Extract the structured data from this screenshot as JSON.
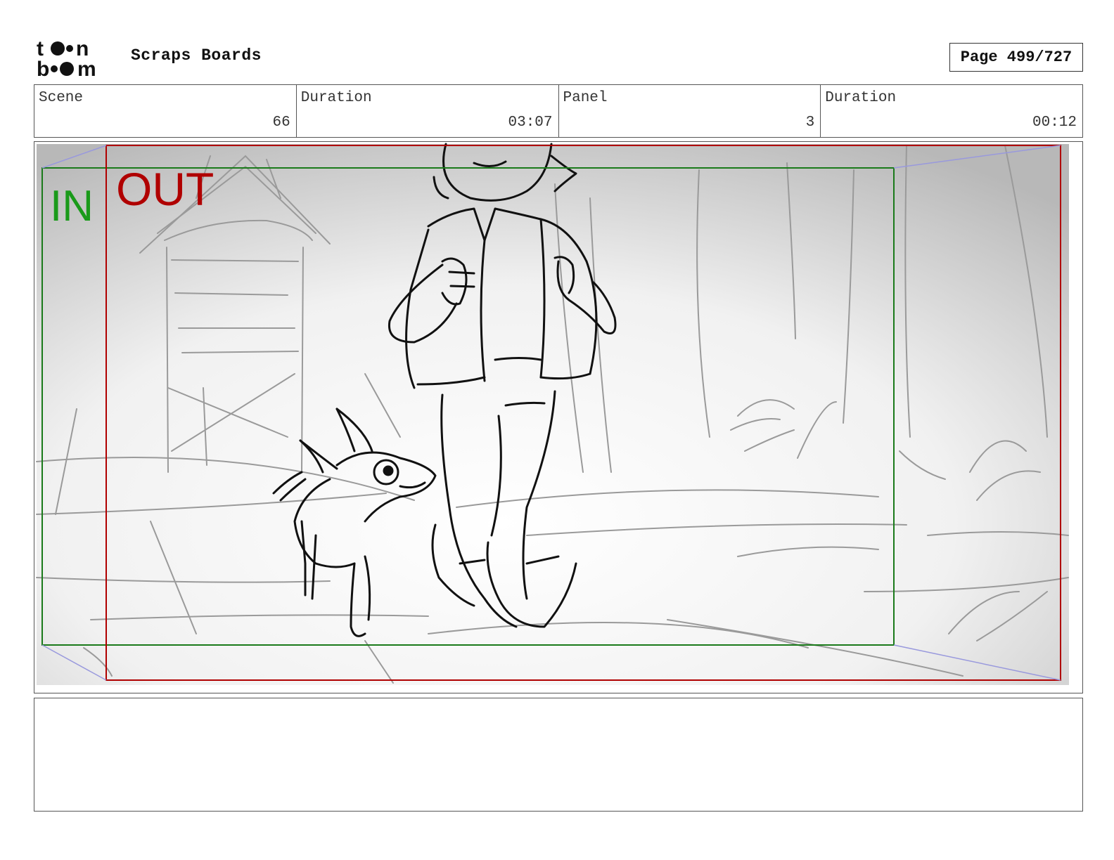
{
  "header": {
    "logo_text": "toon boom",
    "title": "Scraps Boards",
    "page_label": "Page 499/727"
  },
  "info": {
    "scene_label": "Scene",
    "scene_value": "66",
    "scene_duration_label": "Duration",
    "scene_duration_value": "03:07",
    "panel_label": "Panel",
    "panel_value": "3",
    "panel_duration_label": "Duration",
    "panel_duration_value": "00:12"
  },
  "panel": {
    "in_label": "IN",
    "out_label": "OUT",
    "in_color": "#1a9a1a",
    "out_color": "#b00000"
  },
  "notes": {
    "text": ""
  }
}
